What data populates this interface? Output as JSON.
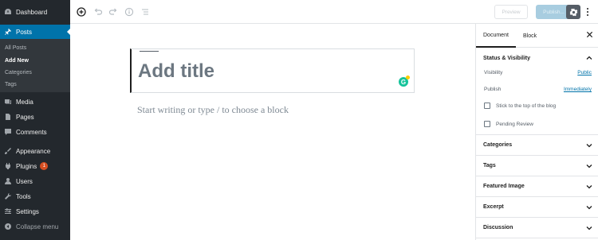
{
  "admin_menu": {
    "items": [
      {
        "label": "Dashboard",
        "icon": "dashboard-icon"
      },
      {
        "label": "Posts",
        "icon": "pin-icon"
      },
      {
        "label": "Media",
        "icon": "media-icon"
      },
      {
        "label": "Pages",
        "icon": "page-icon"
      },
      {
        "label": "Comments",
        "icon": "comment-icon"
      },
      {
        "label": "Appearance",
        "icon": "brush-icon"
      },
      {
        "label": "Plugins",
        "icon": "plugin-icon",
        "badge": "1"
      },
      {
        "label": "Users",
        "icon": "user-icon"
      },
      {
        "label": "Tools",
        "icon": "wrench-icon"
      },
      {
        "label": "Settings",
        "icon": "settings-icon"
      },
      {
        "label": "Collapse menu",
        "icon": "collapse-icon"
      }
    ],
    "submenu": [
      "All Posts",
      "Add New",
      "Categories",
      "Tags"
    ]
  },
  "toolbar": {
    "preview_label": "Preview",
    "publish_label": "Publish..."
  },
  "editor": {
    "title_placeholder": "Add title",
    "body_placeholder": "Start writing or type / to choose a block",
    "grammarly_letter": "G"
  },
  "settings_sidebar": {
    "tabs": [
      "Document",
      "Block"
    ],
    "status_visibility": {
      "heading": "Status & Visibility",
      "visibility_label": "Visibility",
      "visibility_value": "Public",
      "publish_label": "Publish",
      "publish_value": "Immediately",
      "sticky_label": "Stick to the top of the blog",
      "pending_label": "Pending Review"
    },
    "panels": [
      "Categories",
      "Tags",
      "Featured Image",
      "Excerpt",
      "Discussion"
    ]
  },
  "colors": {
    "admin_bg": "#23282d",
    "accent": "#0073aa",
    "publish_disabled": "#a8cde0",
    "plugin_badge": "#d54e21"
  }
}
